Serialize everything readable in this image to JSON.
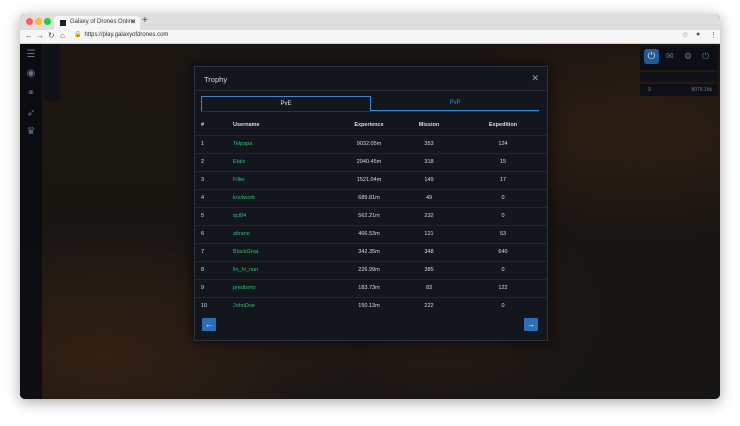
{
  "browser": {
    "tab_title": "Galaxy of Drones Online",
    "url": "https://play.galaxyofdrones.com",
    "colors": {
      "close": "#fe5f57",
      "minimize": "#febc2e",
      "maximize": "#28c840"
    }
  },
  "hud": {
    "stat": "9",
    "readout": "8076.1hk"
  },
  "modal": {
    "title": "Trophy",
    "tabs": [
      {
        "label": "PvE",
        "active": true
      },
      {
        "label": "PvP",
        "active": false
      }
    ],
    "columns": [
      "#",
      "Username",
      "Experience",
      "Mission",
      "Expedition"
    ],
    "rows": [
      {
        "rank": "1",
        "username": "Telpapa",
        "experience": "9032.05m",
        "mission": "353",
        "expedition": "124"
      },
      {
        "rank": "2",
        "username": "Etalz",
        "experience": "2940.45m",
        "mission": "318",
        "expedition": "15"
      },
      {
        "rank": "3",
        "username": "Filler",
        "experience": "1521.04m",
        "mission": "149",
        "expedition": "17"
      },
      {
        "rank": "4",
        "username": "knotwork",
        "experience": "689.81m",
        "mission": "49",
        "expedition": "0"
      },
      {
        "rank": "5",
        "username": "qci84",
        "experience": "562.21m",
        "mission": "232",
        "expedition": "0"
      },
      {
        "rank": "6",
        "username": "altrano",
        "experience": "466.53m",
        "mission": "121",
        "expedition": "53"
      },
      {
        "rank": "7",
        "username": "BlackGnat",
        "experience": "342.35m",
        "mission": "348",
        "expedition": "640"
      },
      {
        "rank": "8",
        "username": "lin_hi_nun",
        "experience": "226.99m",
        "mission": "385",
        "expedition": "0"
      },
      {
        "rank": "9",
        "username": "predismo",
        "experience": "183.73m",
        "mission": "83",
        "expedition": "122"
      },
      {
        "rank": "10",
        "username": "JohnDoe",
        "experience": "150.13m",
        "mission": "222",
        "expedition": "0"
      }
    ],
    "accent": "#3b88d1",
    "username_color": "#2fbf71"
  },
  "icons": {
    "close": "close-icon",
    "prev": "arrow-left-icon",
    "next": "arrow-right-icon"
  }
}
